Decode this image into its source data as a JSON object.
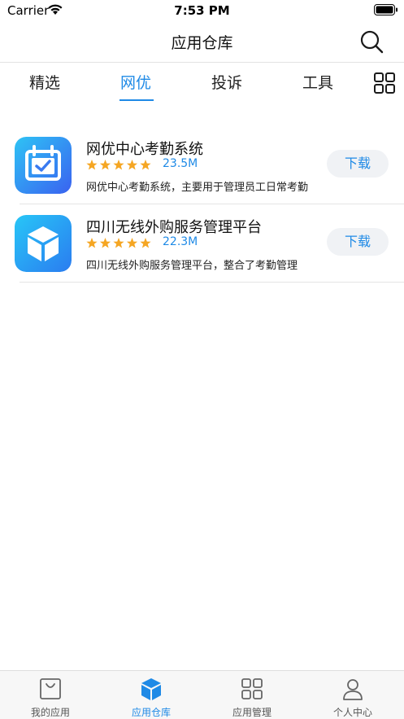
{
  "status_bar": {
    "carrier": "Carrier",
    "time": "7:53 PM"
  },
  "header": {
    "title": "应用仓库",
    "search_icon": "search-icon"
  },
  "tabs": [
    {
      "label": "精选",
      "active": false
    },
    {
      "label": "网优",
      "active": true
    },
    {
      "label": "投诉",
      "active": false
    },
    {
      "label": "工具",
      "active": false
    }
  ],
  "apps": [
    {
      "name": "网优中心考勤系统",
      "rating": 5,
      "size": "23.5M",
      "description": "网优中心考勤系统，主要用于管理员工日常考勤",
      "download_label": "下载",
      "icon": "calendar-check-icon"
    },
    {
      "name": "四川无线外购服务管理平台",
      "rating": 5,
      "size": "22.3M",
      "description": "四川无线外购服务管理平台，整合了考勤管理",
      "download_label": "下载",
      "icon": "cube-icon"
    }
  ],
  "bottom_tabs": [
    {
      "label": "我的应用",
      "icon": "bag-icon",
      "active": false
    },
    {
      "label": "应用仓库",
      "icon": "cube-icon",
      "active": true
    },
    {
      "label": "应用管理",
      "icon": "grid-icon",
      "active": false
    },
    {
      "label": "个人中心",
      "icon": "person-icon",
      "active": false
    }
  ],
  "colors": {
    "accent": "#1f8ae6",
    "star": "#f5a623"
  }
}
